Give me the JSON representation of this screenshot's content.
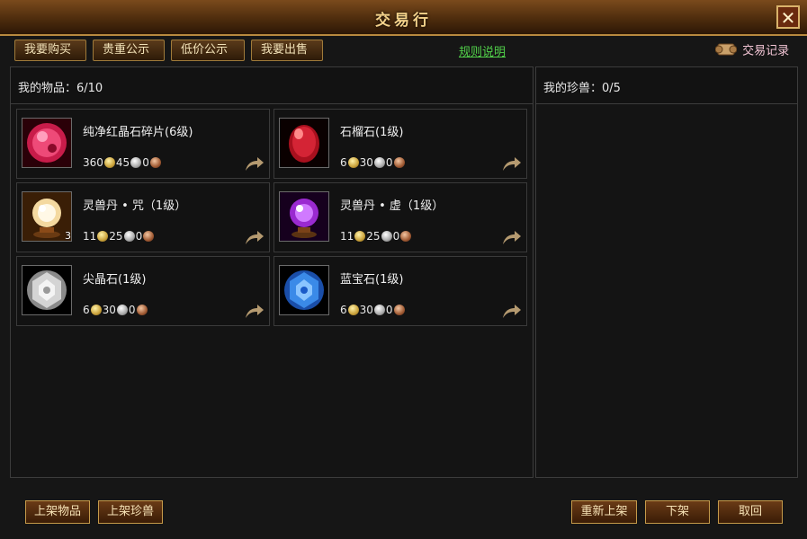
{
  "window": {
    "title": "交易行",
    "close_label": "✕"
  },
  "tabs": [
    {
      "label": "我要购买"
    },
    {
      "label": "贵重公示"
    },
    {
      "label": "低价公示"
    },
    {
      "label": "我要出售"
    }
  ],
  "rules_label": "规则说明",
  "trade_log_label": "交易记录",
  "items_panel": {
    "label": "我的物品：6/10"
  },
  "pets_panel": {
    "label": "我的珍兽：0/5"
  },
  "items": [
    {
      "name": "纯净红晶石碎片(6级)",
      "gold": "360",
      "silver": "45",
      "copper": "0",
      "count": "",
      "icon": "red-crystal-shard-icon"
    },
    {
      "name": "石榴石(1级)",
      "gold": "6",
      "silver": "30",
      "copper": "0",
      "count": "",
      "icon": "garnet-icon"
    },
    {
      "name": "灵兽丹 • 咒（1级）",
      "gold": "11",
      "silver": "25",
      "copper": "0",
      "count": "3",
      "icon": "spirit-pill-curse-icon"
    },
    {
      "name": "灵兽丹 • 虚（1级）",
      "gold": "11",
      "silver": "25",
      "copper": "0",
      "count": "",
      "icon": "spirit-pill-void-icon"
    },
    {
      "name": "尖晶石(1级)",
      "gold": "6",
      "silver": "30",
      "copper": "0",
      "count": "",
      "icon": "spinel-icon"
    },
    {
      "name": "蓝宝石(1级)",
      "gold": "6",
      "silver": "30",
      "copper": "0",
      "count": "",
      "icon": "sapphire-icon"
    }
  ],
  "buttons": {
    "list_item": "上架物品",
    "list_pet": "上架珍兽",
    "relist": "重新上架",
    "delist": "下架",
    "cancel": "取回"
  }
}
